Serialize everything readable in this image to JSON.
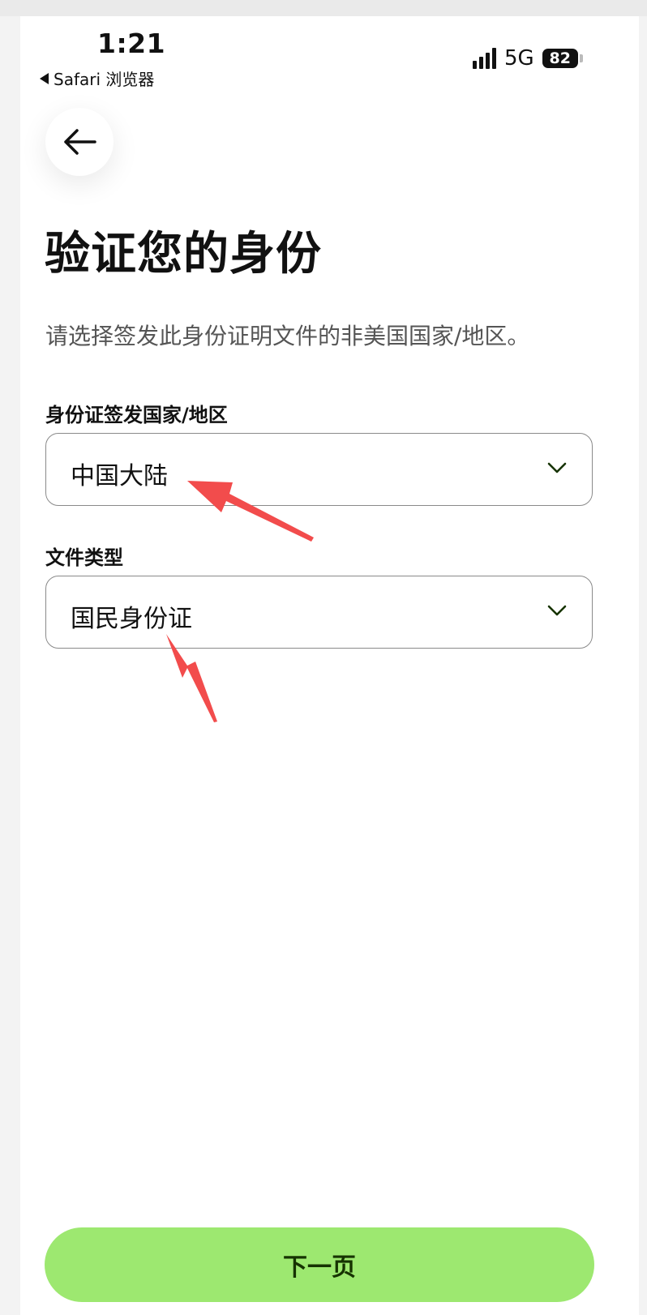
{
  "status_bar": {
    "time": "1:21",
    "back_app": "Safari 浏览器",
    "network": "5G",
    "battery": "82"
  },
  "header": {
    "back_icon": "arrow-left-icon",
    "title": "验证您的身份",
    "subtitle": "请选择签发此身份证明文件的非美国国家/地区。"
  },
  "form": {
    "country": {
      "label": "身份证签发国家/地区",
      "value": "中国大陆",
      "icon": "chevron-down-icon"
    },
    "document_type": {
      "label": "文件类型",
      "value": "国民身份证",
      "icon": "chevron-down-icon"
    }
  },
  "footer": {
    "next_label": "下一页"
  },
  "colors": {
    "primary_button": "#9de870",
    "primary_button_text": "#163300",
    "annotation_arrow": "#f24c4c"
  }
}
